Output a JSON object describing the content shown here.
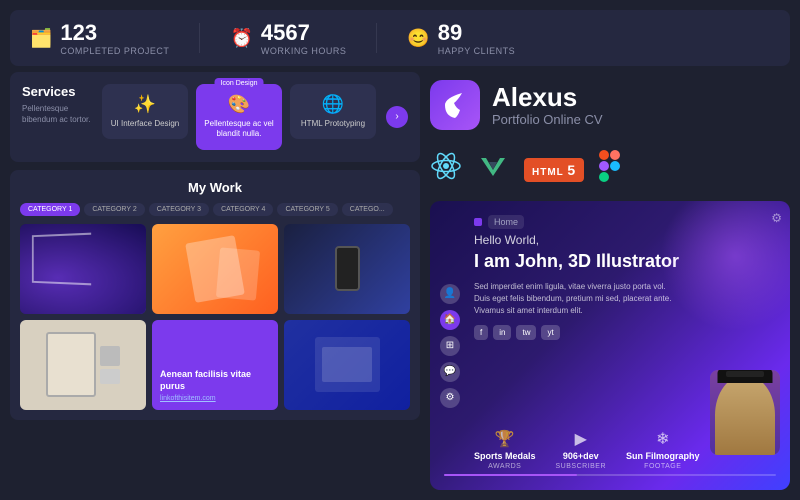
{
  "stats": {
    "completed_projects": {
      "number": "123",
      "label": "Completed Project",
      "icon": "🗂️"
    },
    "working_hours": {
      "number": "4567",
      "label": "Working Hours",
      "icon": "⏰"
    },
    "happy_clients": {
      "number": "89",
      "label": "Happy Clients",
      "icon": "😊"
    }
  },
  "services": {
    "title": "Services",
    "description": "Pellentesque bibendum ac tortor.",
    "cards": [
      {
        "id": 1,
        "label": "UI Interface Design",
        "icon": "✨",
        "active": false,
        "badge": null
      },
      {
        "id": 2,
        "label": "Pellentesque ac vel blandit nulla.",
        "icon": "🎨",
        "active": true,
        "badge": "Icon Design"
      },
      {
        "id": 3,
        "label": "HTML Prototyping",
        "icon": "🌐",
        "active": false,
        "badge": null
      }
    ],
    "next_button": "›"
  },
  "my_work": {
    "title": "My Work",
    "categories": [
      {
        "id": 1,
        "label": "CATEGORY 1",
        "active": true
      },
      {
        "id": 2,
        "label": "CATEGORY 2",
        "active": false
      },
      {
        "id": 3,
        "label": "CATEGORY 3",
        "active": false
      },
      {
        "id": 4,
        "label": "CATEGORY 4",
        "active": false
      },
      {
        "id": 5,
        "label": "CATEGORY 5",
        "active": false
      },
      {
        "id": 6,
        "label": "CATEGO...",
        "active": false
      }
    ],
    "items": [
      {
        "id": 1,
        "type": "abstract"
      },
      {
        "id": 2,
        "type": "geometric"
      },
      {
        "id": 3,
        "type": "phone"
      },
      {
        "id": 4,
        "type": "tablet"
      },
      {
        "id": 5,
        "type": "featured",
        "title": "Aenean facilisis vitae purus",
        "link": "linkofthisitem.com"
      },
      {
        "id": 6,
        "type": "dashboard"
      }
    ]
  },
  "alexus": {
    "name": "Alexus",
    "subtitle": "Portfolio Online CV",
    "logo_icon": "("
  },
  "tech_stack": {
    "icons": [
      "React",
      "Vue",
      "HTML5",
      "Figma"
    ]
  },
  "portfolio": {
    "greeting": "Hello World,",
    "heading": "I am John, 3D Illustrator",
    "description": "Sed imperdiet enim ligula, vitae viverra justo porta vol. Duis eget felis bibendum, pretium mi sed, placerat ante. Vivamus sit amet interdum elit.",
    "social_links": [
      "f",
      "in",
      "tw",
      "yt"
    ],
    "stats": [
      {
        "icon": "🏆",
        "number": "Sports Medals",
        "label": "AWARDS"
      },
      {
        "icon": "▶",
        "number": "906+dev",
        "label": "SUBSCRIBER"
      },
      {
        "icon": "❄",
        "number": "Sun Filmography",
        "label": "FOOTAGE"
      }
    ],
    "gear_icon": "⚙"
  }
}
